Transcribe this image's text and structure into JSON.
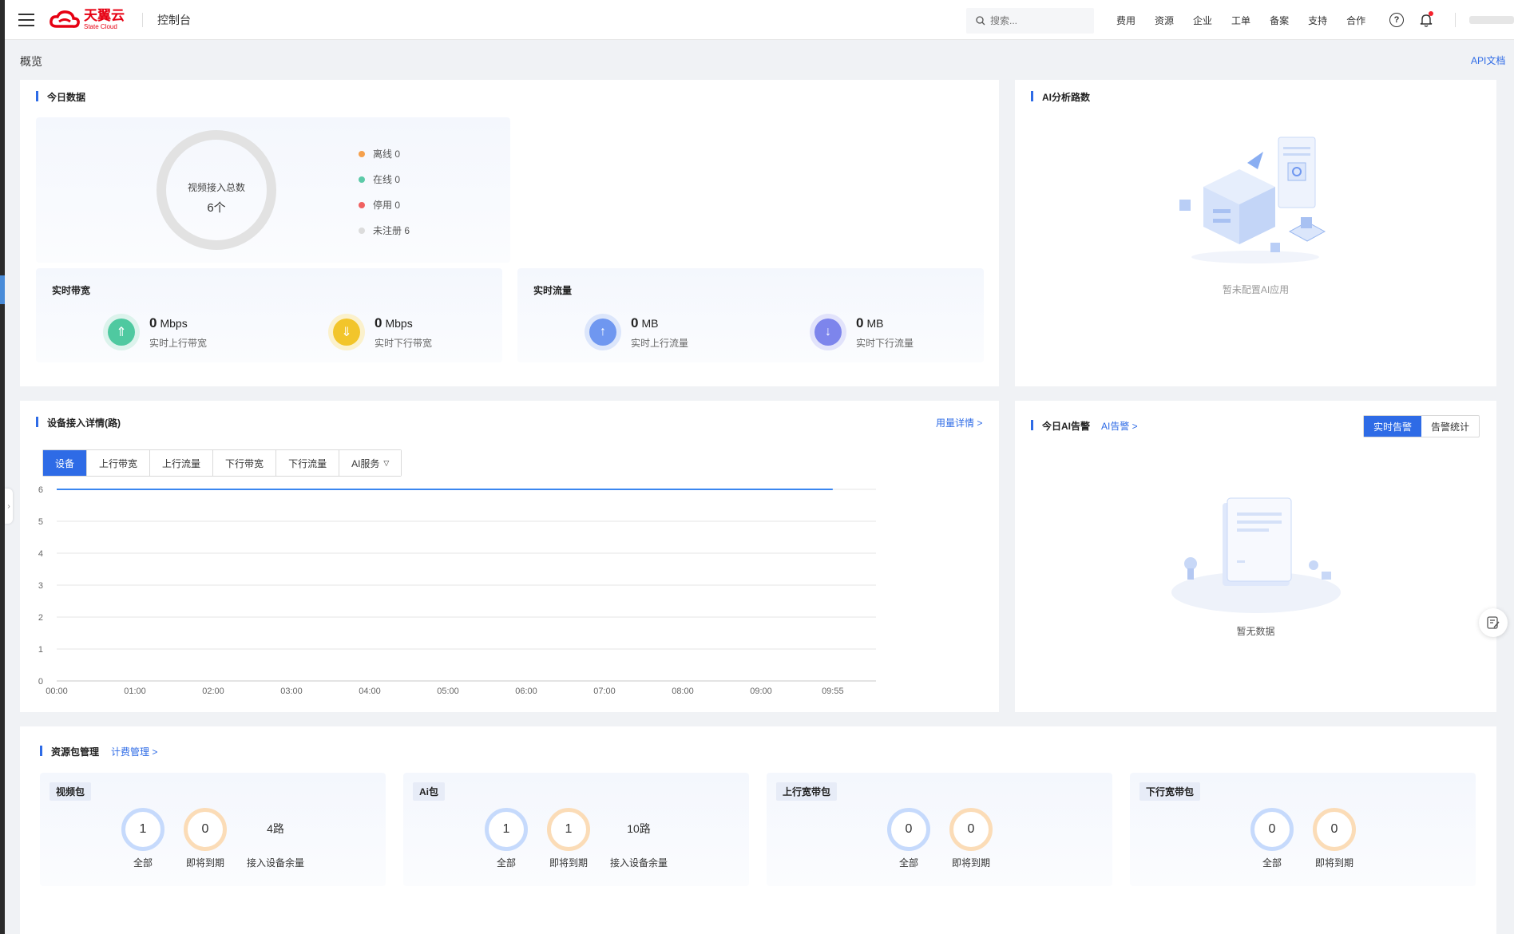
{
  "nav": {
    "logo_cn": "天翼云",
    "logo_en": "State Cloud",
    "console": "控制台",
    "search_placeholder": "搜索...",
    "links": [
      "费用",
      "资源",
      "企业",
      "工单",
      "备案",
      "支持",
      "合作"
    ],
    "help_glyph": "?"
  },
  "page": {
    "title": "概览",
    "api_doc": "API文档"
  },
  "today": {
    "title": "今日数据",
    "donut_label": "视频接入总数",
    "donut_value": "6个",
    "legend": [
      {
        "label": "离线 0",
        "color": "#f5a04c"
      },
      {
        "label": "在线 0",
        "color": "#5ccaa8"
      },
      {
        "label": "停用 0",
        "color": "#f06161"
      },
      {
        "label": "未注册 6",
        "color": "#dcdcdc"
      }
    ],
    "bandwidth": {
      "title": "实时带宽",
      "up_value": "0",
      "up_unit": "Mbps",
      "up_label": "实时上行带宽",
      "down_value": "0",
      "down_unit": "Mbps",
      "down_label": "实时下行带宽"
    },
    "traffic": {
      "title": "实时流量",
      "up_value": "0",
      "up_unit": "MB",
      "up_label": "实时上行流量",
      "down_value": "0",
      "down_unit": "MB",
      "down_label": "实时下行流量"
    }
  },
  "ai_routes": {
    "title": "AI分析路数",
    "empty": "暂未配置AI应用"
  },
  "device": {
    "title": "设备接入详情(路)",
    "usage_link": "用量详情 >",
    "tabs": [
      "设备",
      "上行带宽",
      "上行流量",
      "下行带宽",
      "下行流量",
      "AI服务"
    ],
    "active_tab": "设备"
  },
  "chart_data": {
    "type": "line",
    "x": [
      "00:00",
      "01:00",
      "02:00",
      "03:00",
      "04:00",
      "05:00",
      "06:00",
      "07:00",
      "08:00",
      "09:00",
      "09:55"
    ],
    "series": [
      {
        "values": [
          6,
          6,
          6,
          6,
          6,
          6,
          6,
          6,
          6,
          6,
          6
        ],
        "color": "#3a86f0"
      }
    ],
    "yticks": [
      "0",
      "1",
      "2",
      "3",
      "4",
      "5",
      "6"
    ],
    "ylim": [
      0,
      6
    ],
    "grid": true
  },
  "ai_alarm": {
    "title": "今日AI告警",
    "link": "AI告警 >",
    "buttons": [
      "实时告警",
      "告警统计"
    ],
    "empty": "暂无数据"
  },
  "resources": {
    "title": "资源包管理",
    "link": "计费管理 >",
    "packages": [
      {
        "title": "视频包",
        "all": "1",
        "all_label": "全部",
        "expiring": "0",
        "expiring_label": "即将到期",
        "remain": "4路",
        "remain_label": "接入设备余量"
      },
      {
        "title": "Ai包",
        "all": "1",
        "all_label": "全部",
        "expiring": "1",
        "expiring_label": "即将到期",
        "remain": "10路",
        "remain_label": "接入设备余量"
      },
      {
        "title": "上行宽带包",
        "all": "0",
        "all_label": "全部",
        "expiring": "0",
        "expiring_label": "即将到期"
      },
      {
        "title": "下行宽带包",
        "all": "0",
        "all_label": "全部",
        "expiring": "0",
        "expiring_label": "即将到期"
      }
    ]
  }
}
